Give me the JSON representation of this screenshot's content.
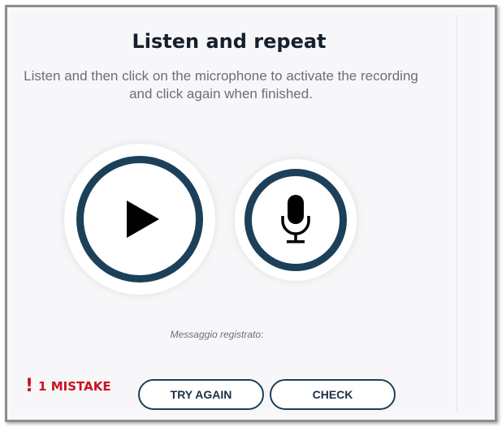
{
  "exercise": {
    "title": "Listen and repeat",
    "instruction": "Listen and then click on the microphone to activate the recording and click again when finished."
  },
  "player": {
    "play_icon": "play-icon",
    "mic_icon": "microphone-icon"
  },
  "recording": {
    "status_label": "Messaggio registrato:"
  },
  "feedback": {
    "icon": "!",
    "mistake_text": "1 MISTAKE"
  },
  "actions": {
    "try_again_label": "TRY AGAIN",
    "check_label": "CHECK"
  },
  "colors": {
    "ring": "#1c4059",
    "error": "#c8141e",
    "text": "#16202b",
    "muted": "#6c6f73",
    "background": "#f7f7f9"
  }
}
